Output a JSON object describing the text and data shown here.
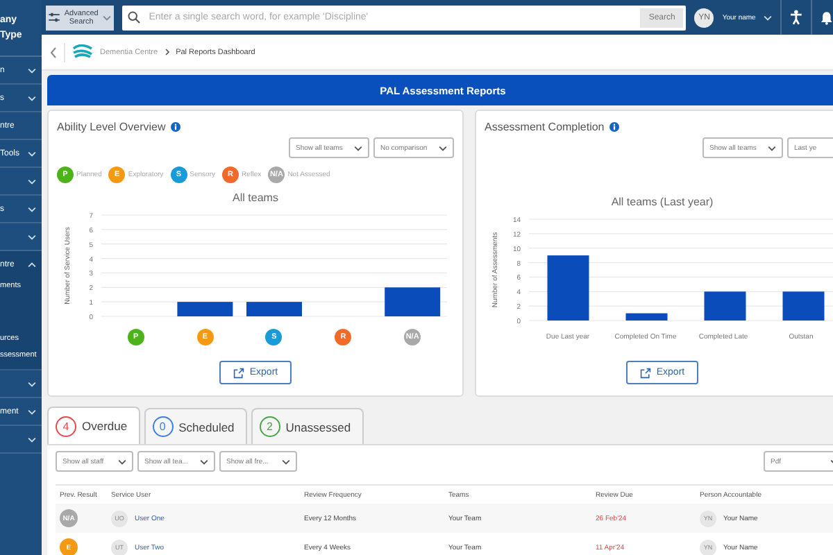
{
  "sidebar": {
    "header": [
      "any",
      "Type"
    ],
    "items": [
      {
        "kind": "group",
        "label": "n",
        "expanded": false
      },
      {
        "kind": "group",
        "label": "s",
        "expanded": false
      },
      {
        "kind": "link",
        "label": "ntre"
      },
      {
        "kind": "group",
        "label": "Tools",
        "expanded": false
      },
      {
        "kind": "group",
        "expanded": false
      },
      {
        "kind": "group",
        "label": "s",
        "expanded": false
      },
      {
        "kind": "group",
        "expanded": false
      },
      {
        "kind": "group",
        "label": "ntre",
        "expanded": true,
        "children": [
          {
            "label": "ments"
          },
          {
            "label": "urces"
          },
          {
            "label": "ssessment"
          }
        ]
      },
      {
        "kind": "group",
        "expanded": false
      },
      {
        "kind": "group",
        "label": "ment",
        "expanded": false
      },
      {
        "kind": "group",
        "expanded": false
      }
    ]
  },
  "top_bar": {
    "advanced_search": "Advanced Search",
    "search": {
      "placeholder": "Enter a single search word, for example 'Discipline'"
    },
    "search_button": "Search",
    "user": {
      "initials": "YN",
      "name": "Your name"
    }
  },
  "breadcrumb": [
    "Dementia Centre",
    "Pal Reports Dashboard"
  ],
  "banner": {
    "title": "PAL Assessment Reports"
  },
  "ability_card": {
    "title": "Ability Level Overview",
    "filters": [
      "Show all teams",
      "No comparison"
    ],
    "legend": [
      {
        "code": "P",
        "label": "Planned",
        "color": "#4db31a"
      },
      {
        "code": "E",
        "label": "Exploratory",
        "color": "#f39a12"
      },
      {
        "code": "S",
        "label": "Sensory",
        "color": "#1a9bd7"
      },
      {
        "code": "R",
        "label": "Reflex",
        "color": "#f26a2a"
      },
      {
        "code": "N/A",
        "label": "Not Assessed",
        "color": "#a9a9a9"
      }
    ],
    "chart_data": {
      "type": "bar",
      "title": "All teams",
      "ylabel": "Number of Service Users",
      "categories": [
        "P",
        "E",
        "S",
        "R",
        "N/A"
      ],
      "values": [
        0,
        1,
        1,
        0,
        2
      ],
      "ylim": [
        0,
        7
      ],
      "grid": true,
      "yticks": [
        0,
        1,
        2,
        3,
        4,
        5,
        6,
        7
      ]
    },
    "export": "Export"
  },
  "completion_card": {
    "title": "Assessment Completion",
    "filters": [
      "Show all teams",
      "Last ye"
    ],
    "chart_data": {
      "type": "bar",
      "title": "All teams (Last year)",
      "ylabel": "Number of Assessments",
      "categories": [
        "Due Last year",
        "Completed On Time",
        "Completed Late",
        "Outstan"
      ],
      "values": [
        9,
        1,
        4,
        4
      ],
      "ylim": [
        0,
        14
      ],
      "grid": true,
      "yticks": [
        0,
        2,
        4,
        6,
        8,
        10,
        12,
        14
      ]
    },
    "export": "Export"
  },
  "tabs": [
    {
      "count": "4",
      "label": "Overdue",
      "color": "#e5484d",
      "selected": true
    },
    {
      "count": "0",
      "label": "Scheduled",
      "color": "#3d7fdc",
      "selected": false
    },
    {
      "count": "2",
      "label": "Unassessed",
      "color": "#45a845",
      "selected": false
    }
  ],
  "table": {
    "filters": [
      "Show all staff",
      "Show all tea...",
      "Show all fre..."
    ],
    "format": "Pdf",
    "columns": [
      "Prev. Result",
      "Service User",
      "Review Frequency",
      "Teams",
      "Review Due",
      "Person Accountable"
    ],
    "rows": [
      {
        "prev_result": "N/A",
        "color": "#a9a9a9",
        "user_initials": "UO",
        "user": "User One",
        "frequency": "Every 12 Months",
        "team": "Your Team",
        "review_due": "26 Feb'24",
        "overdue": true,
        "person_initials": "YN",
        "person": "Your Name"
      },
      {
        "prev_result": "E",
        "color": "#f39a12",
        "user_initials": "UT",
        "user": "User Two",
        "frequency": "Every 4 Weeks",
        "team": "Your Team",
        "review_due": "11 Apr'24",
        "overdue": true,
        "person_initials": "YN",
        "person": "Your Name"
      }
    ]
  }
}
